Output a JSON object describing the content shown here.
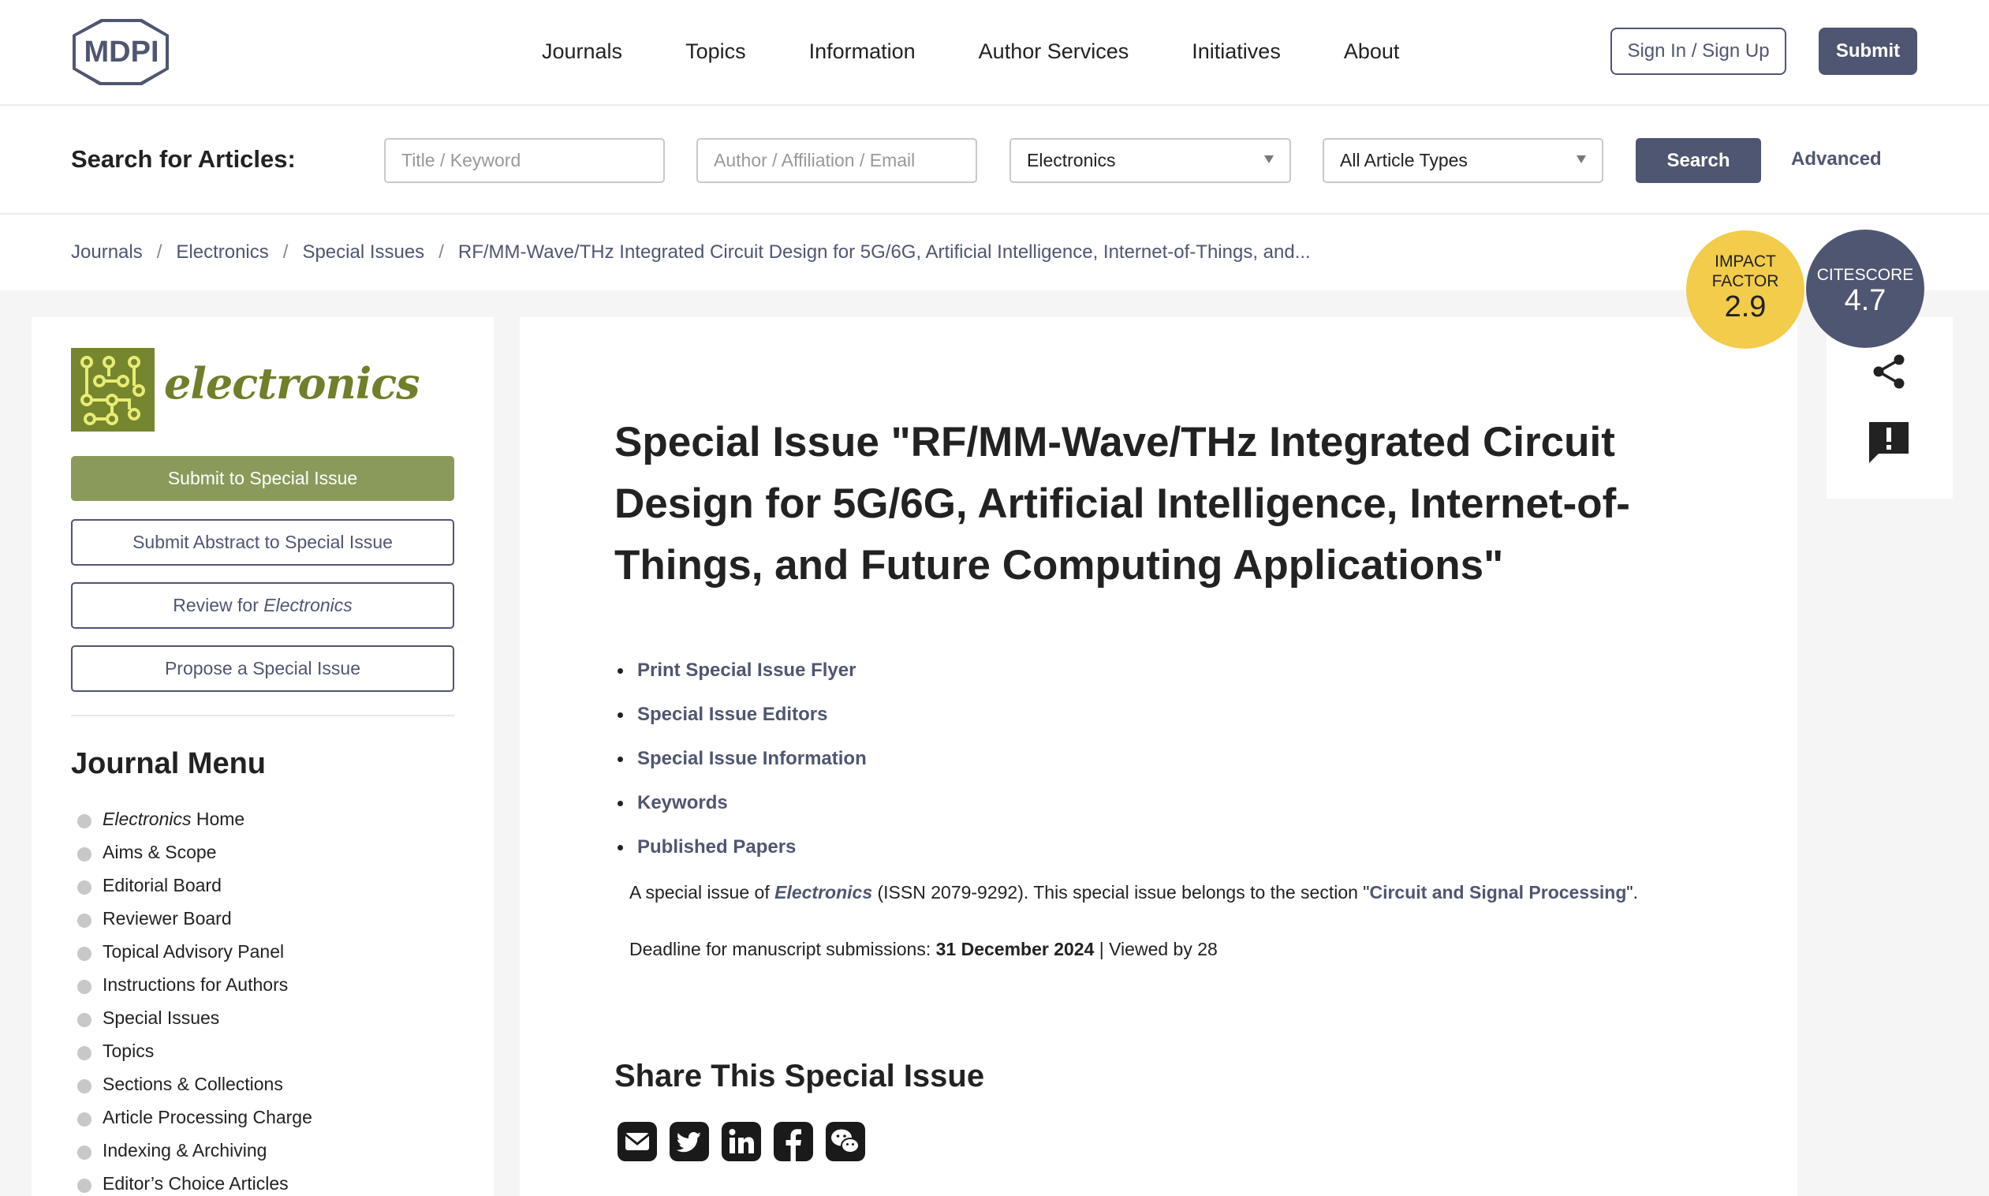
{
  "header": {
    "logo_text": "MDPI",
    "nav": [
      "Journals",
      "Topics",
      "Information",
      "Author Services",
      "Initiatives",
      "About"
    ],
    "signin_label": "Sign In / Sign Up",
    "submit_label": "Submit"
  },
  "search": {
    "label": "Search for Articles:",
    "keyword_placeholder": "Title / Keyword",
    "author_placeholder": "Author / Affiliation / Email",
    "journal_selected": "Electronics",
    "type_selected": "All Article Types",
    "search_label": "Search",
    "advanced_label": "Advanced"
  },
  "breadcrumb": [
    "Journals",
    "Electronics",
    "Special Issues",
    "RF/MM-Wave/THz Integrated Circuit Design for 5G/6G, Artificial Intelligence, Internet-of-Things, and..."
  ],
  "badges": {
    "impact_label_1": "IMPACT",
    "impact_label_2": "FACTOR",
    "impact_value": "2.9",
    "citescore_label": "CITESCORE",
    "citescore_value": "4.7",
    "impact_color": "#f2cc4a",
    "citescore_color": "#4f5671"
  },
  "sidebar": {
    "journal_name": "electronics",
    "submit_si": "Submit to Special Issue",
    "submit_abstract": "Submit Abstract to Special Issue",
    "review_prefix": "Review for ",
    "review_journal": "Electronics",
    "propose": "Propose a Special Issue",
    "menu_title": "Journal Menu",
    "menu_home_journal": "Electronics",
    "menu_home_suffix": " Home",
    "menu_items": [
      "Aims & Scope",
      "Editorial Board",
      "Reviewer Board",
      "Topical Advisory Panel",
      "Instructions for Authors",
      "Special Issues",
      "Topics",
      "Sections & Collections",
      "Article Processing Charge",
      "Indexing & Archiving",
      "Editor’s Choice Articles"
    ]
  },
  "main": {
    "title": "Special Issue \"RF/MM-Wave/THz Integrated Circuit Design for 5G/6G, Artificial Intelligence, Internet-of-Things, and Future Computing Applications\"",
    "toc": [
      "Print Special Issue Flyer",
      "Special Issue Editors",
      "Special Issue Information",
      "Keywords",
      "Published Papers"
    ],
    "info_prefix": "A special issue of ",
    "info_journal": "Electronics",
    "info_mid": " (ISSN 2079-9292). This special issue belongs to the section \"",
    "info_section": "Circuit and Signal Processing",
    "info_suffix": "\".",
    "deadline_prefix": "Deadline for manuscript submissions: ",
    "deadline_date": "31 December 2024",
    "viewed": " | Viewed by 28",
    "share_title": "Share This Special Issue",
    "share_icons": [
      "email-icon",
      "twitter-icon",
      "linkedin-icon",
      "facebook-icon",
      "wechat-icon"
    ]
  },
  "colors": {
    "brand": "#4f5671",
    "journal_green": "#8a9a5b"
  }
}
